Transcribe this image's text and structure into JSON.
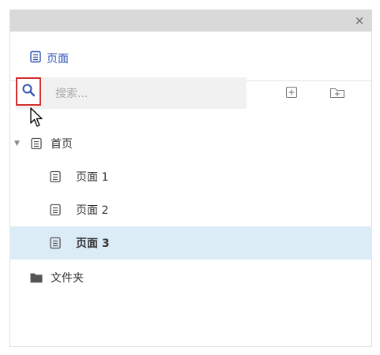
{
  "panel": {
    "close_label": "×"
  },
  "tab": {
    "label": "页面"
  },
  "search": {
    "placeholder": "搜索..."
  },
  "tree": {
    "items": [
      {
        "label": "首页",
        "icon": "document-icon",
        "expanded": true
      },
      {
        "label": "页面 1",
        "icon": "document-icon"
      },
      {
        "label": "页面 2",
        "icon": "document-icon"
      },
      {
        "label": "页面 3",
        "icon": "document-icon",
        "selected": true
      },
      {
        "label": "文件夹",
        "icon": "folder-icon"
      }
    ]
  },
  "colors": {
    "accent": "#2f53b7",
    "selected_row": "#dcecf7",
    "search_highlight": "#d32f2f"
  }
}
